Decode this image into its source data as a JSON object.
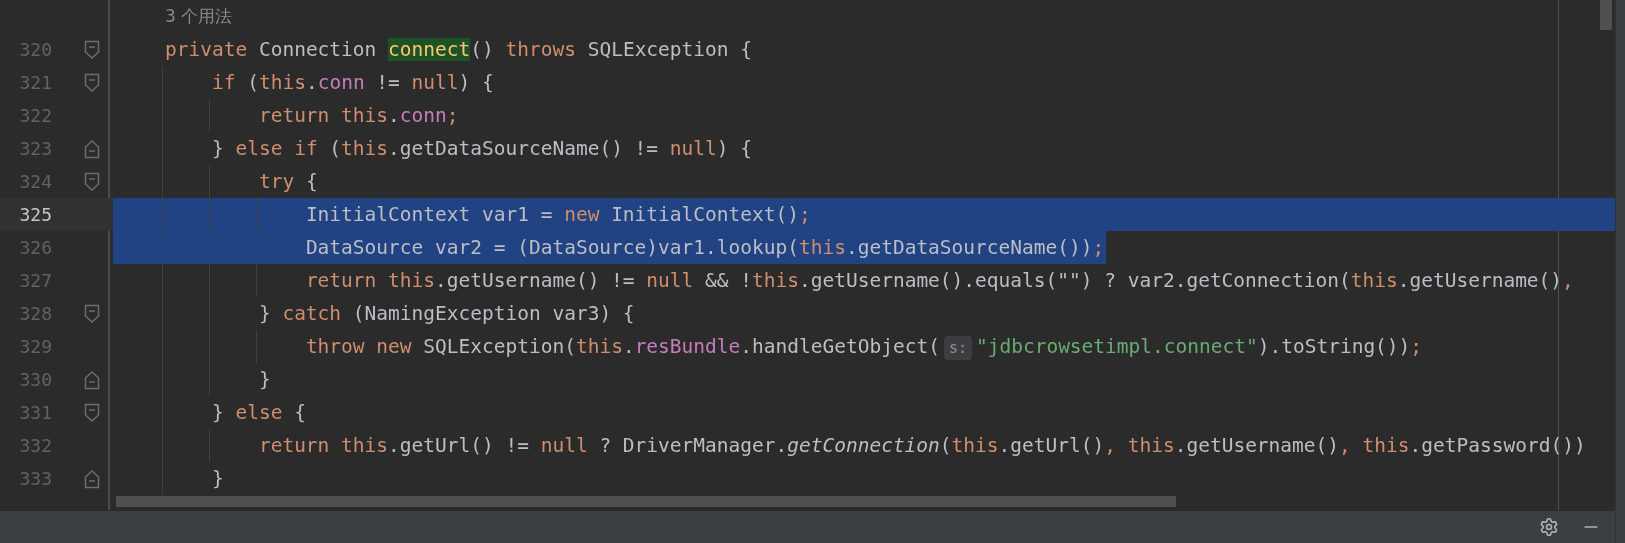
{
  "editor": {
    "usage_hint": "3 个用法",
    "lines": [
      {
        "number": "320",
        "fold_start": true,
        "tokens": [
          {
            "kind": "keyword",
            "text": "private "
          },
          {
            "kind": "plain",
            "text": "Connection "
          },
          {
            "kind": "usage",
            "text": "connect"
          },
          {
            "kind": "plain",
            "text": "() "
          },
          {
            "kind": "keyword",
            "text": "throws "
          },
          {
            "kind": "plain",
            "text": "SQLException {"
          }
        ],
        "children": [
          {
            "number": "321",
            "fold_start": true,
            "tokens": [
              {
                "kind": "keyword",
                "text": "if "
              },
              {
                "kind": "plain",
                "text": "("
              },
              {
                "kind": "keyword",
                "text": "this"
              },
              {
                "kind": "plain",
                "text": "."
              },
              {
                "kind": "field",
                "text": "conn"
              },
              {
                "kind": "plain",
                "text": " != "
              },
              {
                "kind": "keyword",
                "text": "null"
              },
              {
                "kind": "plain",
                "text": ") {"
              }
            ],
            "children": [
              {
                "number": "322",
                "tokens": [
                  {
                    "kind": "keyword",
                    "text": "return this"
                  },
                  {
                    "kind": "plain",
                    "text": "."
                  },
                  {
                    "kind": "field",
                    "text": "conn"
                  },
                  {
                    "kind": "keyword",
                    "text": ";"
                  }
                ]
              }
            ]
          },
          {
            "number": "323",
            "fold_end": true,
            "tokens": [
              {
                "kind": "plain",
                "text": "} "
              },
              {
                "kind": "keyword",
                "text": "else if "
              },
              {
                "kind": "plain",
                "text": "("
              },
              {
                "kind": "keyword",
                "text": "this"
              },
              {
                "kind": "plain",
                "text": ".getDataSourceName() != "
              },
              {
                "kind": "keyword",
                "text": "null"
              },
              {
                "kind": "plain",
                "text": ") {"
              }
            ],
            "children": [
              {
                "number": "324",
                "fold_start": true,
                "tokens": [
                  {
                    "kind": "keyword",
                    "text": "try "
                  },
                  {
                    "kind": "plain",
                    "text": "{"
                  }
                ],
                "children": [
                  {
                    "number": "325",
                    "current": true,
                    "selected": true,
                    "whole_line": true,
                    "tokens": [
                      {
                        "kind": "plain",
                        "text": "InitialContext var1 = "
                      },
                      {
                        "kind": "keyword",
                        "text": "new "
                      },
                      {
                        "kind": "plain",
                        "text": "InitialContext()"
                      },
                      {
                        "kind": "keyword",
                        "text": ";"
                      }
                    ]
                  },
                  {
                    "number": "326",
                    "selected": true,
                    "whole_line": false,
                    "tokens": [
                      {
                        "kind": "plain",
                        "text": "DataSource var2 = (DataSource)var1.lookup("
                      },
                      {
                        "kind": "keyword",
                        "text": "this"
                      },
                      {
                        "kind": "plain",
                        "text": ".getDataSourceName())"
                      },
                      {
                        "kind": "keyword",
                        "text": ";"
                      }
                    ]
                  },
                  {
                    "number": "327",
                    "tokens": [
                      {
                        "kind": "keyword",
                        "text": "return this"
                      },
                      {
                        "kind": "plain",
                        "text": ".getUsername() != "
                      },
                      {
                        "kind": "keyword",
                        "text": "null "
                      },
                      {
                        "kind": "plain",
                        "text": "&& !"
                      },
                      {
                        "kind": "keyword",
                        "text": "this"
                      },
                      {
                        "kind": "plain",
                        "text": ".getUsername().equals(\"\") ? var2.getConnection("
                      },
                      {
                        "kind": "keyword",
                        "text": "this"
                      },
                      {
                        "kind": "plain",
                        "text": ".getUsername()"
                      },
                      {
                        "kind": "keyword",
                        "text": ","
                      }
                    ]
                  }
                ]
              },
              {
                "number": "328",
                "fold_start": true,
                "tokens": [
                  {
                    "kind": "plain",
                    "text": "} "
                  },
                  {
                    "kind": "keyword",
                    "text": "catch "
                  },
                  {
                    "kind": "plain",
                    "text": "(NamingException var3) {"
                  }
                ],
                "children": [
                  {
                    "number": "329",
                    "tokens": [
                      {
                        "kind": "keyword",
                        "text": "throw new "
                      },
                      {
                        "kind": "plain",
                        "text": "SQLException("
                      },
                      {
                        "kind": "keyword",
                        "text": "this"
                      },
                      {
                        "kind": "plain",
                        "text": "."
                      },
                      {
                        "kind": "field",
                        "text": "resBundle"
                      },
                      {
                        "kind": "plain",
                        "text": ".handleGetObject("
                      },
                      {
                        "kind": "hint",
                        "text": "s:"
                      },
                      {
                        "kind": "string",
                        "text": "\"jdbcrowsetimpl.connect\""
                      },
                      {
                        "kind": "plain",
                        "text": ").toString())"
                      },
                      {
                        "kind": "keyword",
                        "text": ";"
                      }
                    ]
                  }
                ]
              },
              {
                "number": "330",
                "fold_end": true,
                "tokens": [
                  {
                    "kind": "plain",
                    "text": "}"
                  }
                ]
              }
            ]
          },
          {
            "number": "331",
            "fold_start": true,
            "tokens": [
              {
                "kind": "plain",
                "text": "} "
              },
              {
                "kind": "keyword",
                "text": "else "
              },
              {
                "kind": "plain",
                "text": "{"
              }
            ],
            "children": [
              {
                "number": "332",
                "tokens": [
                  {
                    "kind": "keyword",
                    "text": "return this"
                  },
                  {
                    "kind": "plain",
                    "text": ".getUrl() != "
                  },
                  {
                    "kind": "keyword",
                    "text": "null "
                  },
                  {
                    "kind": "plain",
                    "text": "? DriverManager."
                  },
                  {
                    "kind": "static",
                    "text": "getConnection"
                  },
                  {
                    "kind": "plain",
                    "text": "("
                  },
                  {
                    "kind": "keyword",
                    "text": "this"
                  },
                  {
                    "kind": "plain",
                    "text": ".getUrl()"
                  },
                  {
                    "kind": "keyword",
                    "text": ", this"
                  },
                  {
                    "kind": "plain",
                    "text": ".getUsername()"
                  },
                  {
                    "kind": "keyword",
                    "text": ", this"
                  },
                  {
                    "kind": "plain",
                    "text": ".getPassword())"
                  }
                ]
              }
            ]
          },
          {
            "number": "333",
            "fold_end": true,
            "tokens": [
              {
                "kind": "plain",
                "text": "}"
              }
            ]
          }
        ]
      }
    ]
  }
}
